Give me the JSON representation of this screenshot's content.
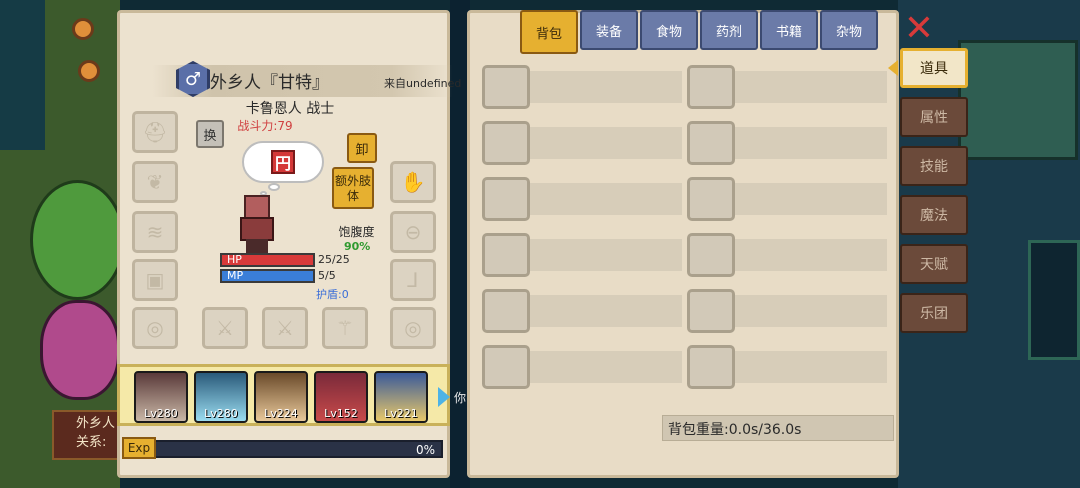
{
  "character": {
    "name": "外乡人『甘特』",
    "origin": "来自undefined",
    "class": "卡鲁恩人 战士",
    "power": "战斗力:79",
    "gender_symbol": "♂",
    "thought_glyph": "円",
    "satiety_label": "饱腹度",
    "satiety_value": "90%",
    "hp_label": "HP",
    "hp_value": "25/25",
    "mp_label": "MP",
    "mp_value": "5/5",
    "shield": "护盾:0"
  },
  "buttons": {
    "swap": "换",
    "unload": "卸",
    "extra_limb": "额外肢体"
  },
  "party": [
    {
      "level": "Lv280",
      "colors": [
        "#5a3a3a",
        "#c9b7a6"
      ]
    },
    {
      "level": "Lv280",
      "colors": [
        "#2a5a7a",
        "#9adcf0"
      ]
    },
    {
      "level": "Lv224",
      "colors": [
        "#6a4a2a",
        "#e8c89a"
      ]
    },
    {
      "level": "Lv152",
      "colors": [
        "#7a2a3a",
        "#c84a4a"
      ]
    },
    {
      "level": "Lv221",
      "colors": [
        "#3a5a9a",
        "#e8c86a"
      ]
    }
  ],
  "party_overflow": "你",
  "exp": {
    "label": "Exp",
    "percent": "0%"
  },
  "tabs": [
    "背包",
    "装备",
    "食物",
    "药剂",
    "书籍",
    "杂物"
  ],
  "active_tab": 0,
  "inventory_weight": "背包重量:0.0s/36.0s",
  "side_nav": [
    "道具",
    "属性",
    "技能",
    "魔法",
    "天赋",
    "乐团"
  ],
  "active_side": 0,
  "peek_label": {
    "line1": "外乡人",
    "line2": "关系:"
  },
  "colors": {
    "accent": "#e6b030",
    "hp": "#d83a3a",
    "mp": "#3a7ed8",
    "power": "#d04040"
  }
}
